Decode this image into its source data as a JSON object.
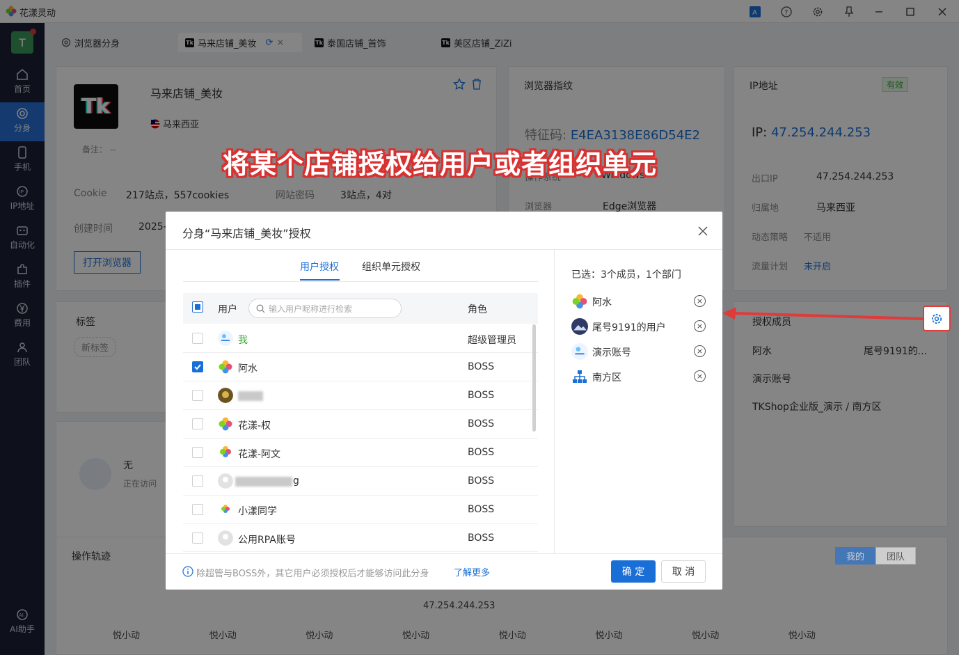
{
  "window": {
    "title": "花漾灵动",
    "controls": [
      "translate-icon",
      "help-icon",
      "gear-icon",
      "pin-icon",
      "minimize-icon",
      "maximize-icon",
      "close-icon"
    ]
  },
  "sidebar": {
    "avatar_letter": "T",
    "items": [
      {
        "label": "首页",
        "icon": "home-icon"
      },
      {
        "label": "分身",
        "icon": "browser-icon",
        "active": true
      },
      {
        "label": "手机",
        "icon": "phone-icon"
      },
      {
        "label": "IP地址",
        "icon": "ip-icon"
      },
      {
        "label": "自动化",
        "icon": "robot-icon"
      },
      {
        "label": "插件",
        "icon": "puzzle-icon"
      },
      {
        "label": "费用",
        "icon": "yen-icon"
      },
      {
        "label": "团队",
        "icon": "team-icon"
      },
      {
        "label": "AI助手",
        "icon": "ai-icon"
      }
    ]
  },
  "tabs": [
    {
      "label": "浏览器分身"
    },
    {
      "label": "马来店铺_美妆",
      "active": true
    },
    {
      "label": "泰国店铺_首饰"
    },
    {
      "label": "美区店铺_ZiZi"
    }
  ],
  "shop": {
    "logo": "Tk",
    "name": "马来店铺_美妆",
    "region": "马来西亚",
    "remark_label": "备注：",
    "remark_value": "--",
    "cookie_label": "Cookie",
    "cookie_value": "217站点，557cookies",
    "pwd_label": "网站密码",
    "pwd_value": "3站点，4对",
    "created_label": "创建时间",
    "created_value": "2025-",
    "open_button": "打开浏览器"
  },
  "fingerprint": {
    "title": "浏览器指纹",
    "code_label": "特征码:",
    "code_value": "E4EA3138E86D54E2",
    "os_label": "操作系统",
    "os_value": "Windows",
    "browser_label": "浏览器",
    "browser_value": "Edge浏览器"
  },
  "ip": {
    "title": "IP地址",
    "status": "有效",
    "ip_label": "IP:",
    "ip_value": "47.254.244.253",
    "exit_label": "出口IP",
    "exit_value": "47.254.244.253",
    "loc_label": "归属地",
    "loc_value": "马来西亚",
    "policy_label": "动态策略",
    "policy_value": "不适用",
    "traffic_label": "流量计划",
    "traffic_value": "未开启"
  },
  "tags": {
    "title": "标签",
    "new_tag": "新标签"
  },
  "visitor": {
    "name": "无",
    "status": "正在访问"
  },
  "authorized": {
    "title": "授权成员",
    "members": [
      "阿水",
      "尾号9191的...",
      "演示账号",
      "TKShop企业版_演示 / 南方区"
    ]
  },
  "trace": {
    "title": "操作轨迹",
    "btn_mine": "我的",
    "btn_team": "团队",
    "center_ip": "47.254.244.253",
    "nodes": [
      "悦小动",
      "悦小动",
      "悦小动",
      "悦小动",
      "悦小动",
      "悦小动",
      "悦小动",
      "悦小动"
    ]
  },
  "caption": "将某个店铺授权给用户或者组织单元",
  "dialog": {
    "title": "分身“马来店铺_美妆”授权",
    "tab_user": "用户授权",
    "tab_org": "组织单元授权",
    "col_user": "用户",
    "search_placeholder": "输入用户昵称进行检索",
    "col_role": "角色",
    "rows": [
      {
        "name": "我",
        "role": "超级管理员",
        "checked": false
      },
      {
        "name": "阿水",
        "role": "BOSS",
        "checked": true
      },
      {
        "name": "",
        "role": "BOSS",
        "checked": false
      },
      {
        "name": "花漾-权",
        "role": "BOSS",
        "checked": false
      },
      {
        "name": "花漾-阿文",
        "role": "BOSS",
        "checked": false
      },
      {
        "name": "g",
        "role": "BOSS",
        "checked": false
      },
      {
        "name": "小漾同学",
        "role": "BOSS",
        "checked": false
      },
      {
        "name": "公用RPA账号",
        "role": "BOSS",
        "checked": false
      }
    ],
    "selected_summary": "已选：3个成员，1个部门",
    "selected": [
      "阿水",
      "尾号9191的用户",
      "演示账号",
      "南方区"
    ],
    "footer_note": "除超管与BOSS外，其它用户必须授权后才能够访问此分身",
    "learn_more": "了解更多",
    "ok": "确 定",
    "cancel": "取 消"
  }
}
